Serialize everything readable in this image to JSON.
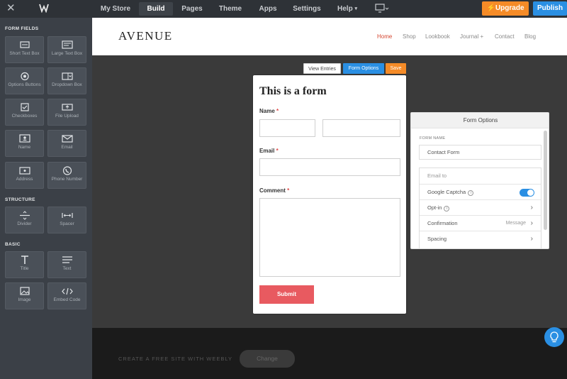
{
  "topbar": {
    "nav": [
      {
        "label": "My Store",
        "active": false
      },
      {
        "label": "Build",
        "active": true
      },
      {
        "label": "Pages",
        "active": false
      },
      {
        "label": "Theme",
        "active": false
      },
      {
        "label": "Apps",
        "active": false
      },
      {
        "label": "Settings",
        "active": false
      },
      {
        "label": "Help",
        "active": false
      }
    ],
    "upgrade_label": "Upgrade",
    "publish_label": "Publish",
    "icons": [
      "close-icon",
      "weebly-logo-icon",
      "monitor-icon",
      "lightning-icon"
    ]
  },
  "sidebar": {
    "sections": [
      {
        "title": "FORM FIELDS",
        "items": [
          "Short Text Box",
          "Large Text Box",
          "Options Buttons",
          "Dropdown Box",
          "Checkboxes",
          "File Upload",
          "Name",
          "Email",
          "Address",
          "Phone Number"
        ]
      },
      {
        "title": "STRUCTURE",
        "items": [
          "Divider",
          "Spacer"
        ]
      },
      {
        "title": "BASIC",
        "items": [
          "Title",
          "Text",
          "Image",
          "Embed Code"
        ]
      }
    ]
  },
  "site": {
    "logo": "AVENUE",
    "nav": [
      "Home",
      "Shop",
      "Lookbook",
      "Journal +",
      "Contact",
      "Blog"
    ],
    "current_nav": "Home",
    "footer_text": "CREATE A FREE SITE WITH WEEBLY",
    "change_label": "Change"
  },
  "form_toolbar": {
    "view_entries": "View Entries",
    "form_options": "Form Options",
    "save": "Save"
  },
  "form": {
    "title": "This is a form",
    "fields": [
      {
        "label": "Name",
        "required": true
      },
      {
        "label": "Email",
        "required": true
      },
      {
        "label": "Comment",
        "required": true
      }
    ],
    "submit_label": "Submit"
  },
  "options_panel": {
    "title": "Form Options",
    "form_name_label": "FORM NAME",
    "form_name_value": "Contact Form",
    "rows": [
      {
        "label": "Email to"
      },
      {
        "label": "Google Captcha",
        "toggle": true
      },
      {
        "label": "Opt-in"
      },
      {
        "label": "Confirmation",
        "value": "Message"
      },
      {
        "label": "Spacing"
      }
    ]
  },
  "colors": {
    "accent_blue": "#2a8fe3",
    "accent_orange": "#f58b27",
    "submit_red": "#e85a60",
    "nav_current": "#d4452f"
  }
}
